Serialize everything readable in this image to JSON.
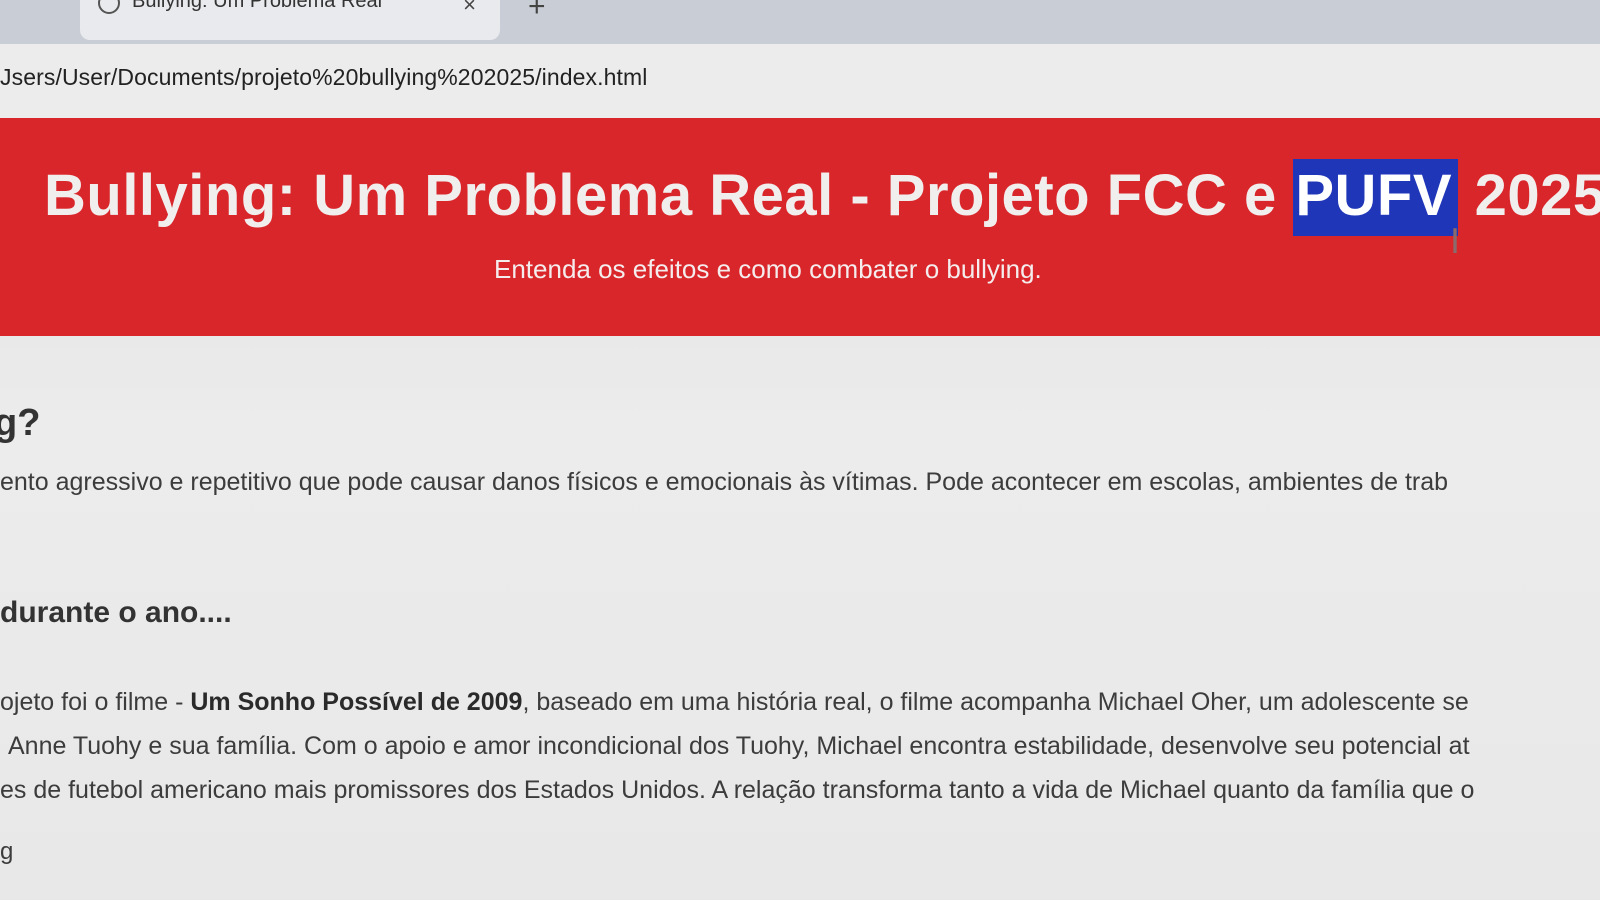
{
  "browser": {
    "tab_title": "Bullying: Um Problema Real",
    "tab_close": "×",
    "new_tab": "+",
    "address": "Jsers/User/Documents/projeto%20bullying%202025/index.html"
  },
  "hero": {
    "title_before": "Bullying: Um Problema Real - Projeto FCC e ",
    "title_selected": "PUFV",
    "title_after": " 2025",
    "subtitle": "Entenda os efeitos e como combater o bullying."
  },
  "sections": {
    "what_heading": "g?",
    "what_text": "ento agressivo e repetitivo que pode causar danos físicos e emocionais às vítimas. Pode acontecer em escolas, ambientes de trab",
    "year_heading": "durante o ano....",
    "year_line1_pre": "ojeto foi o filme - ",
    "year_line1_bold": "Um Sonho Possível de 2009",
    "year_line1_post": ", baseado em uma história real, o filme acompanha Michael Oher, um adolescente se",
    "year_line2": "Anne Tuohy e sua família. Com o apoio e amor incondicional dos Tuohy, Michael encontra estabilidade, desenvolve seu potencial at",
    "year_line3": "es de futebol americano mais promissores dos Estados Unidos. A relação transforma tanto a vida de Michael quanto da família que o",
    "trailing": "g"
  }
}
